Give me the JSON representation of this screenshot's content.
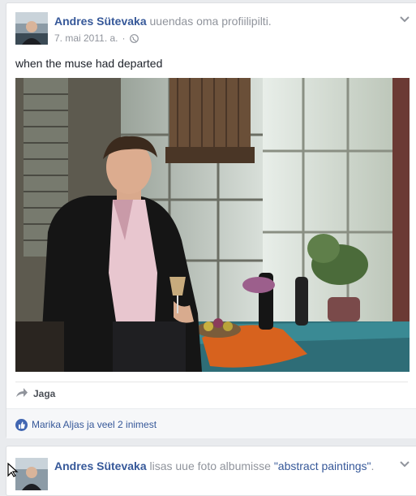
{
  "post1": {
    "author": "Andres Sütevaka",
    "action": "uuendas oma profiilipilti.",
    "date": "7. mai 2011. a.",
    "separator": "·",
    "caption": "when the muse had departed",
    "share_label": "Jaga",
    "reactions_text": "Marika Aljas ja veel 2 inimest",
    "icons": {
      "privacy": "globe-icon",
      "menu": "chevron-down-icon",
      "share": "share-arrow-icon",
      "like": "like-icon"
    }
  },
  "post2": {
    "author": "Andres Sütevaka",
    "action": "lisas uue foto albumisse",
    "album": "\"abstract paintings\"",
    "period": "."
  },
  "colors": {
    "link": "#365899",
    "muted": "#90949c",
    "like": "#4267b2",
    "background": "#e9ebee"
  }
}
